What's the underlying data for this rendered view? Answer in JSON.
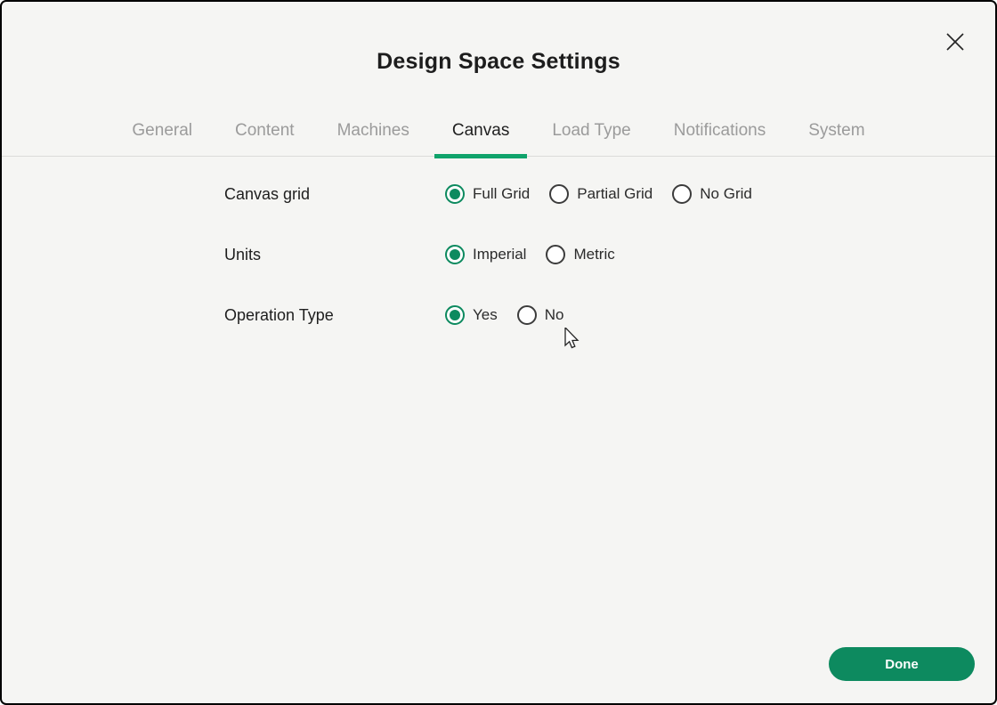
{
  "dialog": {
    "title": "Design Space Settings"
  },
  "tabs": [
    {
      "label": "General",
      "active": false
    },
    {
      "label": "Content",
      "active": false
    },
    {
      "label": "Machines",
      "active": false
    },
    {
      "label": "Canvas",
      "active": true
    },
    {
      "label": "Load Type",
      "active": false
    },
    {
      "label": "Notifications",
      "active": false
    },
    {
      "label": "System",
      "active": false
    }
  ],
  "settings": [
    {
      "label": "Canvas grid",
      "options": [
        "Full Grid",
        "Partial Grid",
        "No Grid"
      ],
      "selected": "Full Grid"
    },
    {
      "label": "Units",
      "options": [
        "Imperial",
        "Metric"
      ],
      "selected": "Imperial"
    },
    {
      "label": "Operation Type",
      "options": [
        "Yes",
        "No"
      ],
      "selected": "Yes"
    }
  ],
  "footer": {
    "done_label": "Done"
  },
  "icons": {
    "close": "close-icon",
    "radio_selected": "radio-selected-icon",
    "radio_unselected": "radio-unselected-icon",
    "cursor": "mouse-cursor-icon"
  },
  "colors": {
    "green_primary": "#0d8a5f",
    "green_accent": "#0fa36b",
    "dialog_background": "#f5f5f3",
    "divider": "#dcdcda",
    "tab_inactive_text": "#9b9b9b",
    "tab_active_text": "#1f1f1f",
    "title_text": "#1d1d1d"
  }
}
